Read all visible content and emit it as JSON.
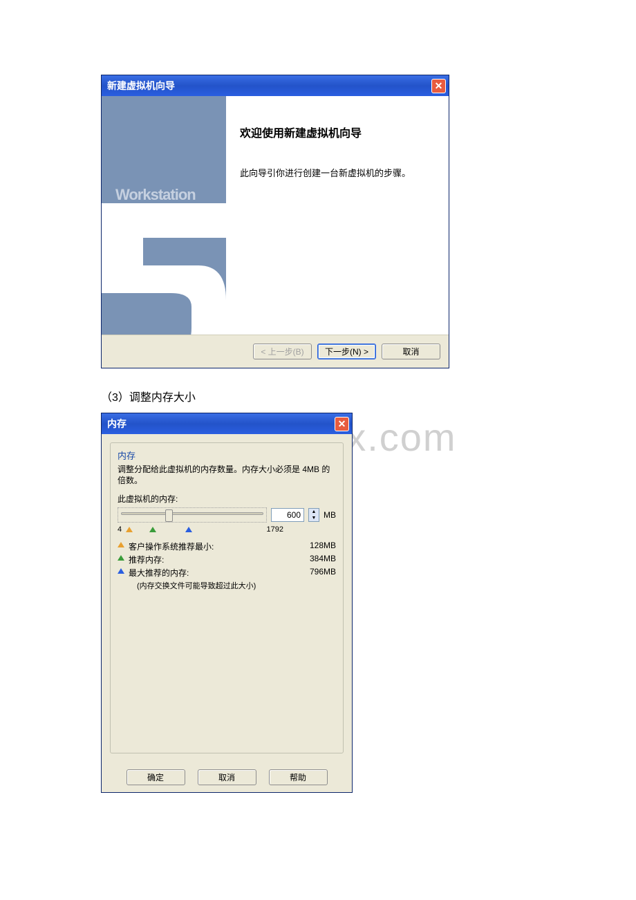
{
  "watermark": "www.bdocx.com",
  "wizard": {
    "title": "新建虚拟机向导",
    "sidebar_label": "Workstation",
    "heading": "欢迎使用新建虚拟机向导",
    "description": "此向导引你进行创建一台新虚拟机的步骤。",
    "back_button": "< 上一步(B)",
    "next_button": "下一步(N) >",
    "cancel_button": "取消"
  },
  "caption": "（3）调整内存大小",
  "memory": {
    "title": "内存",
    "fieldset_title": "内存",
    "fieldset_desc": "调整分配给此虚拟机的内存数量。内存大小必须是 4MB 的倍数。",
    "vm_memory_label": "此虚拟机的内存:",
    "value": "600",
    "unit": "MB",
    "min_marker": "4",
    "max_marker": "1792",
    "rec_min_label": "客户操作系统推荐最小:",
    "rec_min_value": "128MB",
    "rec_label": "推荐内存:",
    "rec_value": "384MB",
    "rec_max_label": "最大推荐的内存:",
    "rec_max_value": "796MB",
    "rec_note": "(内存交换文件可能导致超过此大小)",
    "ok_button": "确定",
    "cancel_button": "取消",
    "help_button": "帮助"
  }
}
